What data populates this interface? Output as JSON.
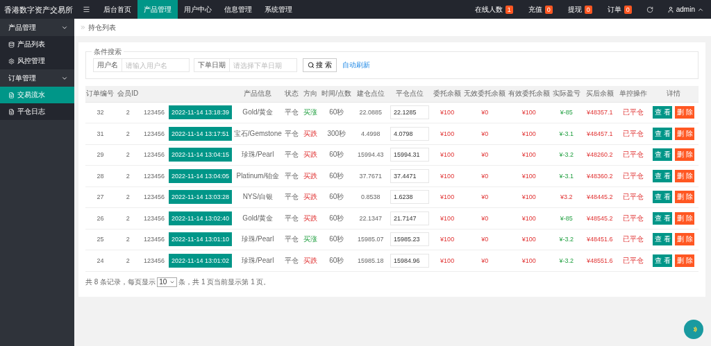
{
  "brand": "香港数字资产交易所",
  "nav": [
    {
      "label": "后台首页",
      "selected": false
    },
    {
      "label": "产品管理",
      "selected": true
    },
    {
      "label": "用户中心",
      "selected": false
    },
    {
      "label": "信息管理",
      "selected": false
    },
    {
      "label": "系统管理",
      "selected": false
    }
  ],
  "counters": [
    {
      "label": "在线人数",
      "count": "1"
    },
    {
      "label": "充值",
      "count": "0"
    },
    {
      "label": "提现",
      "count": "0"
    },
    {
      "label": "订单",
      "count": "0"
    }
  ],
  "user": "admin",
  "sidebar": [
    {
      "label": "产品管理",
      "expanded": true,
      "children": [
        {
          "label": "产品列表",
          "selected": false
        },
        {
          "label": "风控管理",
          "selected": false
        }
      ]
    },
    {
      "label": "订单管理",
      "expanded": true,
      "children": [
        {
          "label": "交易流水",
          "selected": true
        },
        {
          "label": "平仓日志",
          "selected": false
        }
      ]
    }
  ],
  "breadcrumb": "持仓列表",
  "search": {
    "legend": "条件搜索",
    "fields": [
      {
        "label": "用户名",
        "placeholder": "请输入用户名"
      },
      {
        "label": "下单日期",
        "placeholder": "请选择下单日期"
      }
    ],
    "button": "搜 索",
    "link": "自动刷新"
  },
  "table": {
    "columns": [
      "订单编号",
      "会员ID",
      "",
      "",
      "产品信息",
      "状态",
      "方向",
      "时间/点数",
      "建仓点位",
      "平仓点位",
      "委托余额",
      "无效委托余额",
      "有效委托余额",
      "实际盈亏",
      "买后余额",
      "单控操作",
      "详情"
    ],
    "rows": [
      {
        "id": "32",
        "member": "2",
        "column_3": "123456",
        "time": "2022-11-14 13:18:39",
        "product": "Gold/黄金",
        "status": "平仓",
        "direction": "买涨",
        "rising": true,
        "period": "60秒",
        "open": "22.0885",
        "close": "22.1285",
        "entrust": "¥100",
        "invalid": "¥0",
        "valid": "¥100",
        "pnl": "¥-85",
        "profit": false,
        "balance": "¥48357.1",
        "control": "已平仓",
        "actions": [
          "查 看",
          "删 除"
        ]
      },
      {
        "id": "31",
        "member": "2",
        "column_3": "123456",
        "time": "2022-11-14 13:17:51",
        "product": "宝石/Gemstone",
        "status": "平仓",
        "direction": "买跌",
        "rising": false,
        "period": "300秒",
        "open": "4.4998",
        "close": "4.0798",
        "entrust": "¥100",
        "invalid": "¥0",
        "valid": "¥100",
        "pnl": "¥-3.1",
        "profit": false,
        "balance": "¥48457.1",
        "control": "已平仓",
        "actions": [
          "查 看",
          "删 除"
        ]
      },
      {
        "id": "29",
        "member": "2",
        "column_3": "123456",
        "time": "2022-11-14 13:04:15",
        "product": "珍珠/Pearl",
        "status": "平仓",
        "direction": "买跌",
        "rising": false,
        "period": "60秒",
        "open": "15994.43",
        "close": "15994.31",
        "entrust": "¥100",
        "invalid": "¥0",
        "valid": "¥100",
        "pnl": "¥-3.2",
        "profit": false,
        "balance": "¥48260.2",
        "control": "已平仓",
        "actions": [
          "查 看",
          "删 除"
        ]
      },
      {
        "id": "28",
        "member": "2",
        "column_3": "123456",
        "time": "2022-11-14 13:04:05",
        "product": "Platinum/铂金",
        "status": "平仓",
        "direction": "买跌",
        "rising": false,
        "period": "60秒",
        "open": "37.7671",
        "close": "37.4471",
        "entrust": "¥100",
        "invalid": "¥0",
        "valid": "¥100",
        "pnl": "¥-3.1",
        "profit": false,
        "balance": "¥48360.2",
        "control": "已平仓",
        "actions": [
          "查 看",
          "删 除"
        ]
      },
      {
        "id": "27",
        "member": "2",
        "column_3": "123456",
        "time": "2022-11-14 13:03:28",
        "product": "NYS/白银",
        "status": "平仓",
        "direction": "买跌",
        "rising": false,
        "period": "60秒",
        "open": "0.8538",
        "close": "1.6238",
        "entrust": "¥100",
        "invalid": "¥0",
        "valid": "¥100",
        "pnl": "¥3.2",
        "profit": true,
        "balance": "¥48445.2",
        "control": "已平仓",
        "actions": [
          "查 看",
          "删 除"
        ]
      },
      {
        "id": "26",
        "member": "2",
        "column_3": "123456",
        "time": "2022-11-14 13:02:40",
        "product": "Gold/黄金",
        "status": "平仓",
        "direction": "买跌",
        "rising": false,
        "period": "60秒",
        "open": "22.1347",
        "close": "21.7147",
        "entrust": "¥100",
        "invalid": "¥0",
        "valid": "¥100",
        "pnl": "¥-85",
        "profit": false,
        "balance": "¥48545.2",
        "control": "已平仓",
        "actions": [
          "查 看",
          "删 除"
        ]
      },
      {
        "id": "25",
        "member": "2",
        "column_3": "123456",
        "time": "2022-11-14 13:01:10",
        "product": "珍珠/Pearl",
        "status": "平仓",
        "direction": "买涨",
        "rising": true,
        "period": "60秒",
        "open": "15985.07",
        "close": "15985.23",
        "entrust": "¥100",
        "invalid": "¥0",
        "valid": "¥100",
        "pnl": "¥-3.2",
        "profit": false,
        "balance": "¥48451.6",
        "control": "已平仓",
        "actions": [
          "查 看",
          "删 除"
        ]
      },
      {
        "id": "24",
        "member": "2",
        "column_3": "123456",
        "time": "2022-11-14 13:01:02",
        "product": "珍珠/Pearl",
        "status": "平仓",
        "direction": "买跌",
        "rising": false,
        "period": "60秒",
        "open": "15985.18",
        "close": "15984.96",
        "entrust": "¥100",
        "invalid": "¥0",
        "valid": "¥100",
        "pnl": "¥-3.2",
        "profit": false,
        "balance": "¥48551.6",
        "control": "已平仓",
        "actions": [
          "查 看",
          "删 除"
        ]
      }
    ]
  },
  "pager": {
    "before": "共 8 条记录，每页显示",
    "page_size": "10",
    "after": "条，共 1 页当前显示第 1 页。"
  }
}
